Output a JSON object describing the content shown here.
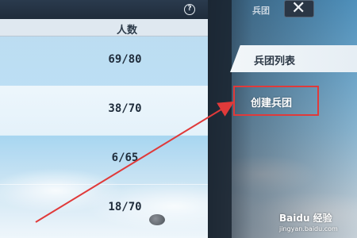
{
  "header": {
    "help_icon": "?"
  },
  "table": {
    "column_header": "人数",
    "rows": [
      {
        "count": "69/80"
      },
      {
        "count": "38/70"
      },
      {
        "count": "6/65"
      },
      {
        "count": "18/70"
      }
    ]
  },
  "panel": {
    "title": "兵团",
    "close_icon": "close-icon",
    "tabs": [
      {
        "label": "兵团列表"
      },
      {
        "label": "创建兵团"
      }
    ]
  },
  "watermark": {
    "text": "Baidu 经验",
    "url": "jingyan.baidu.com"
  },
  "colors": {
    "highlight_box": "#e03a3a",
    "arrow": "#e03a3a"
  }
}
